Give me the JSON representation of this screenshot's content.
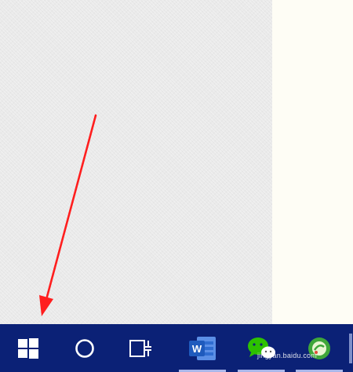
{
  "taskbar": {
    "items": [
      {
        "name": "start-button",
        "icon": "windows-logo-icon"
      },
      {
        "name": "search-button",
        "icon": "cortana-circle-icon"
      },
      {
        "name": "task-view-button",
        "icon": "task-view-icon"
      },
      {
        "name": "word-app-button",
        "icon": "word-icon",
        "label": "W"
      },
      {
        "name": "wechat-app-button",
        "icon": "wechat-icon"
      },
      {
        "name": "app-button-green",
        "icon": "green-app-icon"
      }
    ],
    "colors": {
      "background": "#0b2176",
      "running_indicator": "#a9b7ea",
      "word_blue": "#1f5bbd",
      "wechat_green": "#2dc100"
    }
  },
  "annotation": {
    "color": "#ff1e1e",
    "points_to": "start-button"
  },
  "watermark": {
    "text": "jingyan.baidu.com"
  }
}
